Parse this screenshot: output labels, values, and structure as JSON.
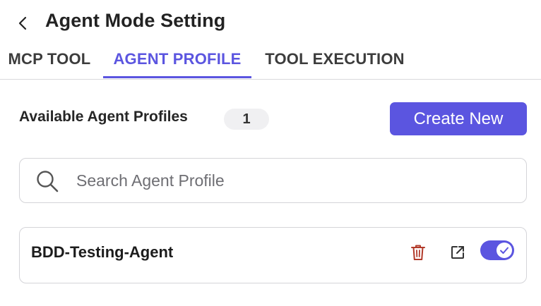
{
  "header": {
    "title": "Agent Mode Setting",
    "back_icon": "chevron-left-icon"
  },
  "tabs": [
    {
      "label": "MCP TOOL",
      "active": false
    },
    {
      "label": "AGENT PROFILE",
      "active": true
    },
    {
      "label": "TOOL EXECUTION",
      "active": false
    }
  ],
  "profiles_section": {
    "label": "Available Agent Profiles",
    "count": "1",
    "create_label": "Create New"
  },
  "search": {
    "placeholder": "Search Agent Profile",
    "value": "",
    "icon": "search-icon"
  },
  "profiles": [
    {
      "name": "BDD-Testing-Agent",
      "enabled": true
    }
  ],
  "colors": {
    "accent": "#5b55e0",
    "delete": "#b23a2a",
    "border": "#d4d4d8"
  }
}
